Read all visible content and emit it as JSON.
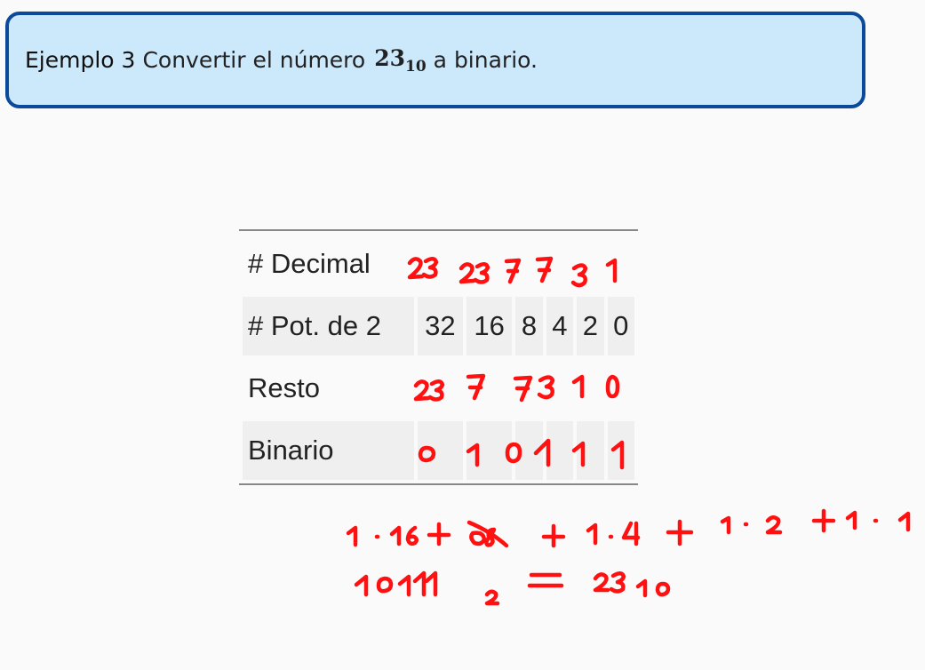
{
  "example": {
    "label": "Ejemplo 3",
    "text_before": "Convertir el número",
    "number": "23",
    "base": "10",
    "text_after": "a binario."
  },
  "table": {
    "rows": [
      {
        "header": "# Decimal",
        "cells": [
          "",
          "",
          "",
          "",
          "",
          ""
        ]
      },
      {
        "header": "# Pot. de 2",
        "cells": [
          "32",
          "16",
          "8",
          "4",
          "2",
          "0"
        ]
      },
      {
        "header": "Resto",
        "cells": [
          "",
          "",
          "",
          "",
          "",
          ""
        ]
      },
      {
        "header": "Binario",
        "cells": [
          "",
          "",
          "",
          "",
          "",
          ""
        ]
      }
    ]
  },
  "handwriting": {
    "ink_color": "#ff1111",
    "decimal_row": [
      "23",
      "23",
      "7",
      "7",
      "3",
      "1"
    ],
    "resto_row": [
      "23",
      "7",
      "7",
      "3",
      "1",
      "0"
    ],
    "binario_row": [
      "0",
      "1",
      "0",
      "1",
      "1",
      "1"
    ],
    "sum_line": "1·16 + 0·8 + 1·4 + 1·2 + 1·1",
    "result_line": "10111₂ = 23₁₀"
  }
}
